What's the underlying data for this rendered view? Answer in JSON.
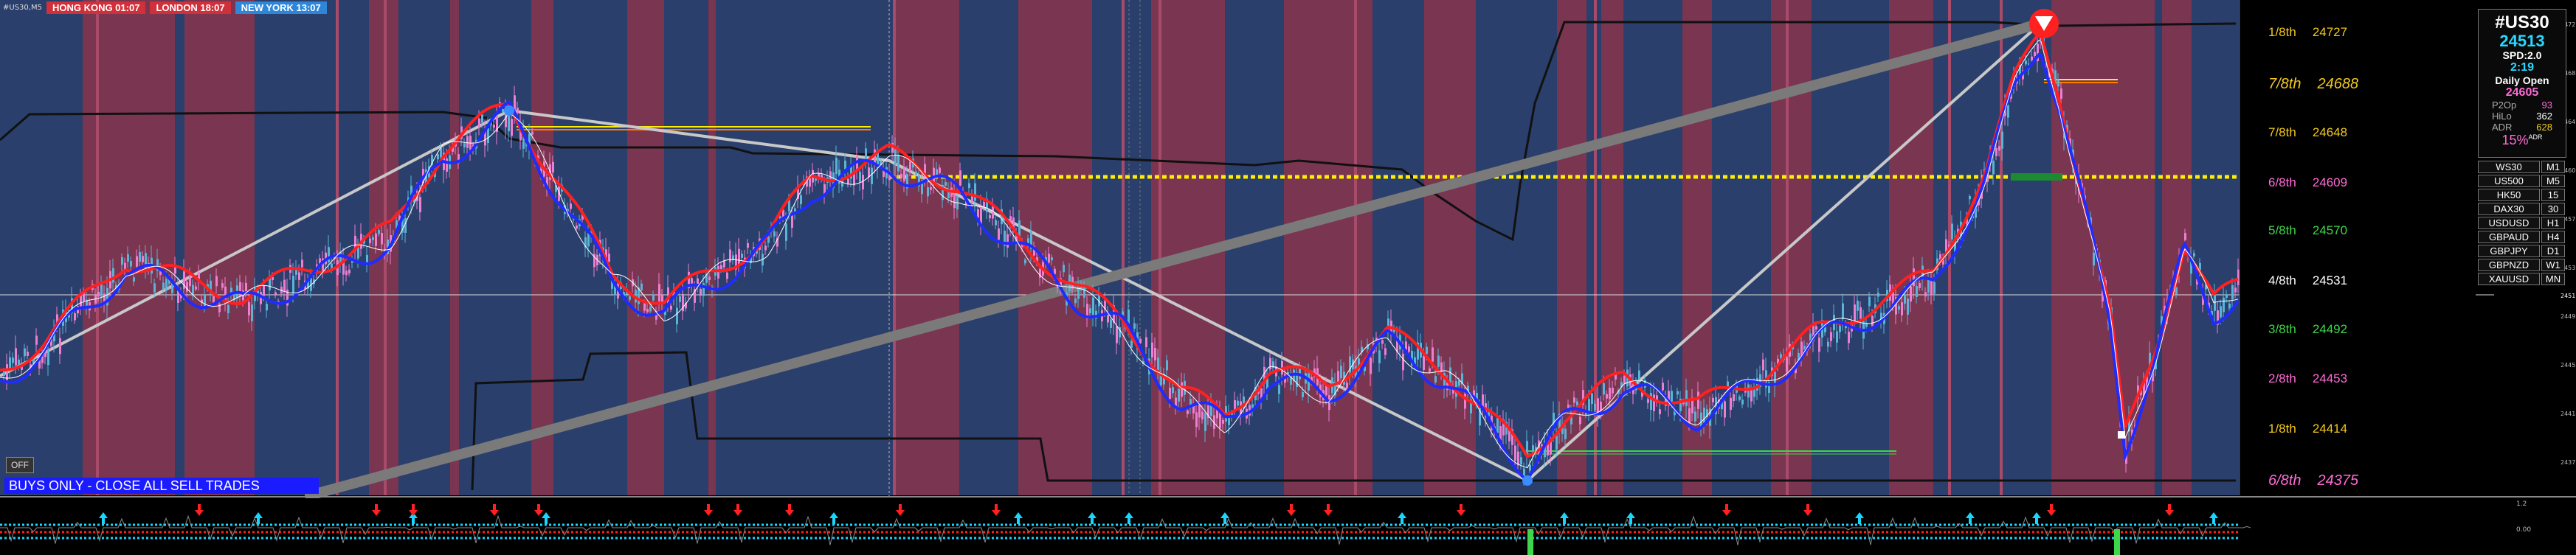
{
  "header": {
    "symbol_label": "#US30,M5",
    "sessions": [
      {
        "label": "HONG KONG 01:07",
        "color": "#d0303a"
      },
      {
        "label": "LONDON  18:07",
        "color": "#d0303a"
      },
      {
        "label": "NEW YORK  13:07",
        "color": "#2e86d9"
      }
    ]
  },
  "banner": {
    "text": "BUYS ONLY - CLOSE ALL SELL TRADES",
    "off_label": "OFF"
  },
  "murrey_levels": [
    {
      "label": "1/8th",
      "value": "24727",
      "color": "#f2c81e",
      "italic": false,
      "row": 0
    },
    {
      "label": "7/8th",
      "value": "24688",
      "color": "#f2c81e",
      "italic": true,
      "row": 1
    },
    {
      "label": "7/8th",
      "value": "24648",
      "color": "#f2c81e",
      "italic": false,
      "row": 2
    },
    {
      "label": "6/8th",
      "value": "24609",
      "color": "#ff6bd6",
      "italic": false,
      "row": 3
    },
    {
      "label": "5/8th",
      "value": "24570",
      "color": "#3ed64a",
      "italic": false,
      "row": 4
    },
    {
      "label": "4/8th",
      "value": "24531",
      "color": "#ffffff",
      "italic": false,
      "row": 5
    },
    {
      "label": "3/8th",
      "value": "24492",
      "color": "#3ed64a",
      "italic": false,
      "row": 6
    },
    {
      "label": "2/8th",
      "value": "24453",
      "color": "#ff6bd6",
      "italic": false,
      "row": 7
    },
    {
      "label": "1/8th",
      "value": "24414",
      "color": "#f2c81e",
      "italic": false,
      "row": 8
    },
    {
      "label": "6/8th",
      "value": "24375",
      "color": "#ff6bd6",
      "italic": true,
      "row": 9
    }
  ],
  "info_panel": {
    "symbol": "#US30",
    "price": "24513",
    "spread": "SPD:2.0",
    "time": "2:19",
    "daily_open_label": "Daily Open",
    "daily_open_value": "24605",
    "stats": [
      {
        "label": "P2Op",
        "value": "93",
        "color": "#ff6bd6"
      },
      {
        "label": "HiLo",
        "value": "362",
        "color": "#ffffff"
      },
      {
        "label": "ADR",
        "value": "628",
        "color": "#f2c81e"
      }
    ],
    "pct_adr": "15%",
    "adr_small": "ADR"
  },
  "symbol_list": [
    {
      "symbol": "WS30",
      "tf": "M1"
    },
    {
      "symbol": "US500",
      "tf": "M5"
    },
    {
      "symbol": "HK50",
      "tf": "15"
    },
    {
      "symbol": "DAX30",
      "tf": "30"
    },
    {
      "symbol": "USDUSD",
      "tf": "H1"
    },
    {
      "symbol": "GBPAUD",
      "tf": "H4"
    },
    {
      "symbol": "GBPJPY",
      "tf": "D1"
    },
    {
      "symbol": "GBPNZD",
      "tf": "W1"
    },
    {
      "symbol": "XAUUSD",
      "tf": "MN"
    }
  ],
  "price_axis": {
    "labels": [
      "24727",
      "24688",
      "24648",
      "24609",
      "24570",
      "24531",
      "24492",
      "24453",
      "24414",
      "24375"
    ],
    "current": "24513"
  },
  "sub_axis": {
    "top": "1.2",
    "bottom": "0.00"
  },
  "colors": {
    "blue_zone": "#2a3f6b",
    "red_zone": "#7a3550",
    "bull_candle": "#5ab4d8",
    "bear_candle": "#ee7fd0",
    "blue_ma": "#1f2cff",
    "red_ma": "#ff2020",
    "yellow_line": "#ffee00"
  }
}
